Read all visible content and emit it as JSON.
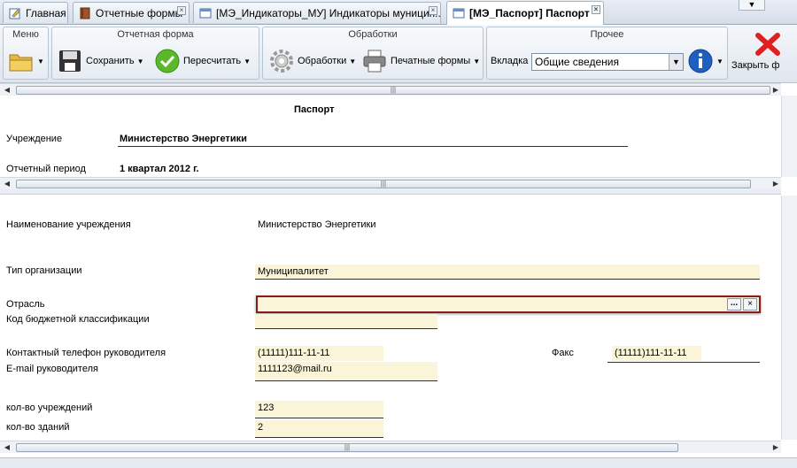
{
  "tabs": [
    {
      "label": "Главная",
      "icon": "edit-icon"
    },
    {
      "label": "Отчетные формы",
      "icon": "book-icon"
    },
    {
      "label": "[МЭ_Индикаторы_МУ] Индикаторы муницип...",
      "icon": "form-icon"
    },
    {
      "label": "[МЭ_Паспорт] Паспорт",
      "icon": "form-icon"
    }
  ],
  "toolbar": {
    "menu": {
      "title": "Меню"
    },
    "report_form": {
      "title": "Отчетная форма",
      "save_label": "Сохранить",
      "recalc_label": "Пересчитать"
    },
    "processing": {
      "title": "Обработки",
      "processing_label": "Обработки",
      "print_label": "Печатные формы"
    },
    "other": {
      "title": "Прочее",
      "tab_label": "Вкладка",
      "tab_value": "Общие сведения"
    },
    "close_label": "Закрыть ф"
  },
  "header": {
    "title": "Паспорт",
    "institution_label": "Учреждение",
    "institution_value": "Министерство Энергетики",
    "period_label": "Отчетный период",
    "period_value": "1 квартал 2012 г."
  },
  "form": {
    "name_label": "Наименование учреждения",
    "name_value": "Министерство Энергетики",
    "org_type_label": "Тип организации",
    "org_type_value": "Муниципалитет",
    "industry_label": "Отрасль",
    "industry_value": "",
    "budget_code_label": "Код бюджетной классификации",
    "budget_code_value": "",
    "phone_label": "Контактный телефон руководителя",
    "phone_value": "(11111)111-11-11",
    "fax_label": "Факс",
    "fax_value": "(11111)111-11-11",
    "email_label": "E-mail руководителя",
    "email_value": "1111123@mail.ru",
    "institutions_label": "кол-во учреждений",
    "institutions_value": "123",
    "buildings_label": "кол-во зданий",
    "buildings_value": "2"
  },
  "colors": {
    "field_bg": "#faf5d8",
    "focus_border": "#8b1a1a",
    "close_red": "#e02020",
    "info_blue": "#1f5fbf",
    "ok_green": "#5cb82a"
  }
}
